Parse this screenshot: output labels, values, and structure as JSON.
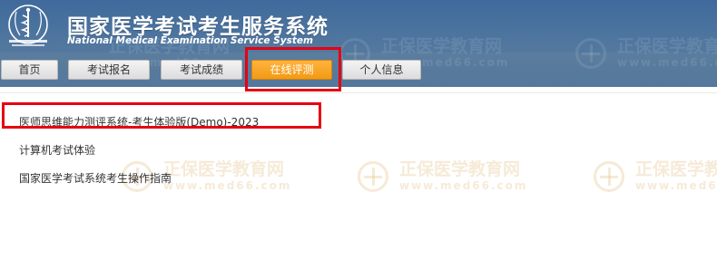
{
  "header": {
    "title_cn": "国家医学考试考生服务系统",
    "title_en": "National Medical Examination Service System"
  },
  "nav": {
    "items": [
      {
        "label": "首页"
      },
      {
        "label": "考试报名"
      },
      {
        "label": "考试成绩"
      },
      {
        "label": "在线评测",
        "active": true
      },
      {
        "label": "个人信息"
      }
    ]
  },
  "links": [
    {
      "label": "医师思维能力测评系统-考生体验版(Demo)-2023"
    },
    {
      "label": "计算机考试体验"
    },
    {
      "label": "国家医学考试系统考生操作指南"
    }
  ],
  "watermark": {
    "brand": "正保医学教育网",
    "url": "www.med66.com"
  },
  "colors": {
    "header_blue": "#4a719c",
    "active_orange": "#f7a21b",
    "highlight_red": "#e60012"
  }
}
